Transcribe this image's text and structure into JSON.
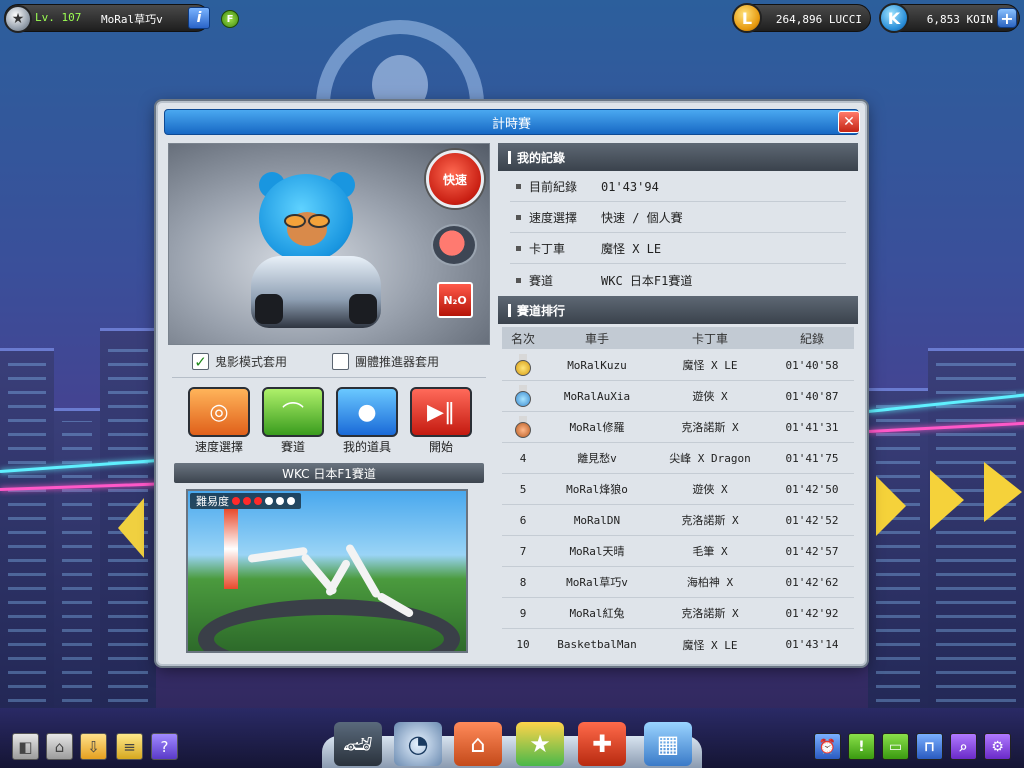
{
  "top_bar": {
    "level": "Lv. 107",
    "nickname": "MoRal草巧v",
    "info_icon": "info-icon",
    "f_badge": "F",
    "lucci_amount": "264,896 LUCCI",
    "koin_amount": "6,853 KOIN",
    "lucci_symbol": "L",
    "koin_symbol": "K"
  },
  "dialog": {
    "title": "計時賽",
    "close_icon": "close-icon",
    "mode_button": "快速",
    "n2o_label": "N₂O",
    "ghost_mode_label": "鬼影模式套用",
    "ghost_mode_checked": true,
    "team_booster_label": "團體推進器套用",
    "team_booster_checked": false,
    "actions": [
      {
        "label": "速度選擇",
        "icon": "speedometer-icon"
      },
      {
        "label": "賽道",
        "icon": "track-icon"
      },
      {
        "label": "我的道具",
        "icon": "item-bag-icon"
      },
      {
        "label": "開始",
        "icon": "play-pause-icon"
      }
    ],
    "track_title": "WKC 日本F1賽道",
    "difficulty_label": "難易度",
    "difficulty_level": 3,
    "difficulty_max": 6
  },
  "my_record": {
    "header": "我的記錄",
    "rows": [
      {
        "key": "目前紀錄",
        "value": "01'43'94"
      },
      {
        "key": "速度選擇",
        "value": "快速 / 個人賽"
      },
      {
        "key": "卡丁車",
        "value": "魔怪 X LE"
      },
      {
        "key": "賽道",
        "value": "WKC 日本F1賽道"
      }
    ]
  },
  "ranking": {
    "header": "賽道排行",
    "columns": [
      "名次",
      "車手",
      "卡丁車",
      "紀錄"
    ],
    "rows": [
      {
        "rank": "1",
        "medal": "gold",
        "driver": "MoRalKuzu",
        "kart": "魔怪 X LE",
        "time": "01'40'58"
      },
      {
        "rank": "2",
        "medal": "silver",
        "driver": "MoRalAuXia",
        "kart": "遊俠 X",
        "time": "01'40'87"
      },
      {
        "rank": "3",
        "medal": "bronze",
        "driver": "MoRal修羅",
        "kart": "克洛諾斯 X",
        "time": "01'41'31"
      },
      {
        "rank": "4",
        "medal": "",
        "driver": "離見愁v",
        "kart": "尖峰 X Dragon",
        "time": "01'41'75"
      },
      {
        "rank": "5",
        "medal": "",
        "driver": "MoRal烽狼o",
        "kart": "遊俠 X",
        "time": "01'42'50"
      },
      {
        "rank": "6",
        "medal": "",
        "driver": "MoRalDN",
        "kart": "克洛諾斯 X",
        "time": "01'42'52"
      },
      {
        "rank": "7",
        "medal": "",
        "driver": "MoRal天晴",
        "kart": "毛筆 X",
        "time": "01'42'57"
      },
      {
        "rank": "8",
        "medal": "",
        "driver": "MoRal草巧v",
        "kart": "海柏神 X",
        "time": "01'42'62"
      },
      {
        "rank": "9",
        "medal": "",
        "driver": "MoRal紅兔",
        "kart": "克洛諾斯 X",
        "time": "01'42'92"
      },
      {
        "rank": "10",
        "medal": "",
        "driver": "BasketbalMan",
        "kart": "魔怪 X LE",
        "time": "01'43'14"
      }
    ]
  },
  "bottom_left_icons": [
    "layers-icon",
    "home-icon",
    "download-icon",
    "notes-icon",
    "help-icon"
  ],
  "bottom_dock_icons": [
    "kart-garage-icon",
    "speedometer-icon",
    "workshop-icon",
    "shop-icon",
    "toolbox-icon",
    "city-icon"
  ],
  "bottom_right_icons": [
    "alarm-icon",
    "alert-icon",
    "chat-icon",
    "mailbox-icon",
    "search-icon",
    "settings-icon"
  ],
  "colors": {
    "title_bar": "#1768c4",
    "panel_header": "#3a424c",
    "close": "#c42414",
    "level_text": "#9cff52"
  }
}
